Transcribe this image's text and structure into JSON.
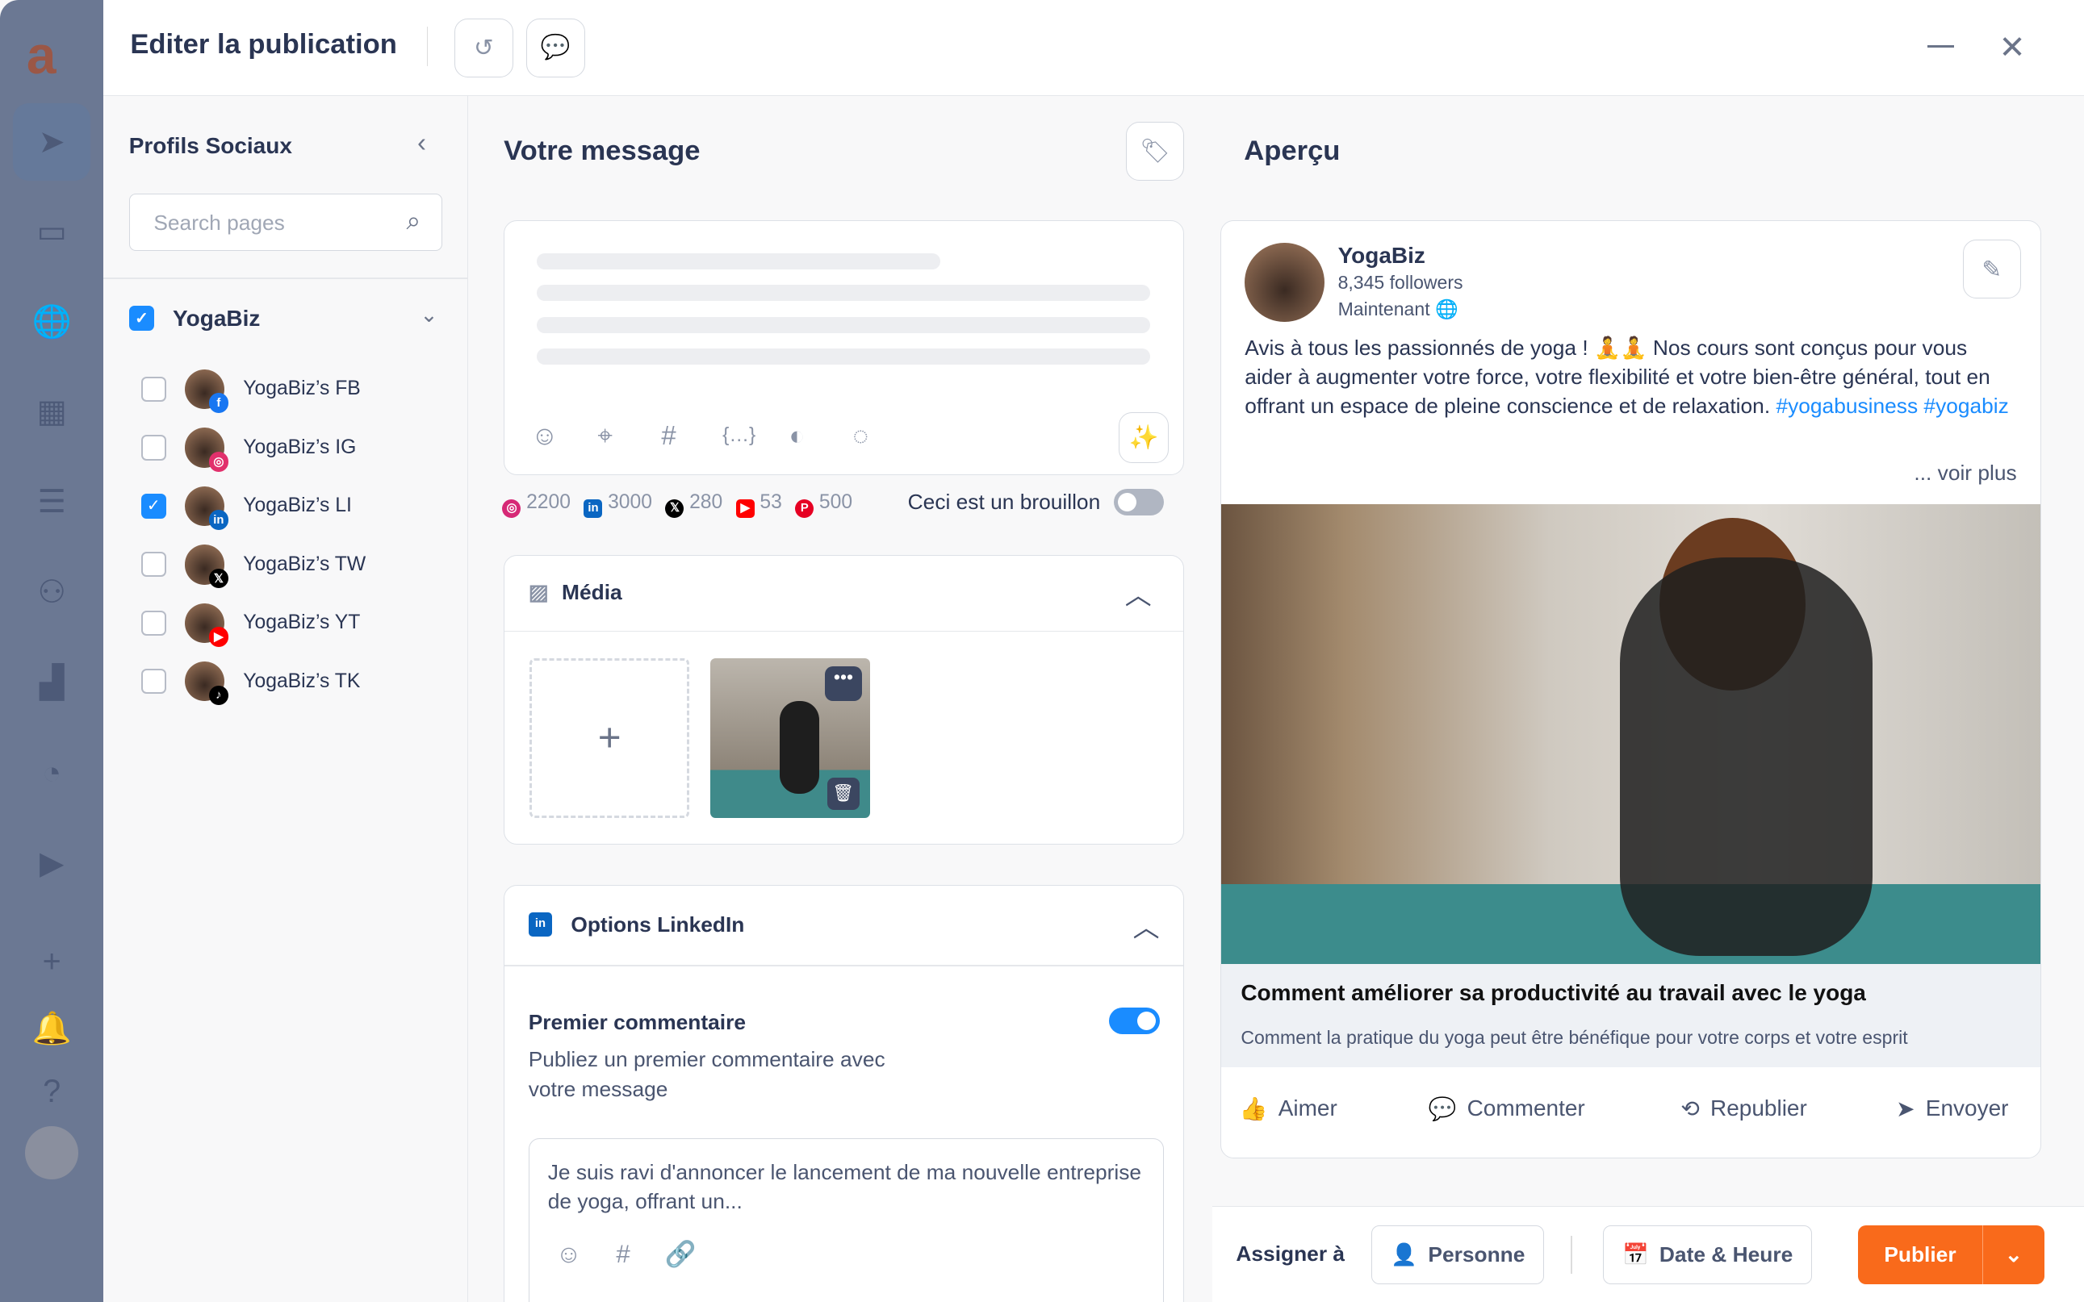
{
  "header": {
    "title": "Editer la publication",
    "history_icon": "history-icon",
    "comments_icon": "comments-icon"
  },
  "profiles": {
    "title": "Profils Sociaux",
    "search_placeholder": "Search pages",
    "group": "YogaBiz",
    "items": [
      {
        "label": "YogaBiz’s FB",
        "checked": false,
        "net": "facebook",
        "color": "#1877f2"
      },
      {
        "label": "YogaBiz’s IG",
        "checked": false,
        "net": "instagram",
        "color": "#e1306c"
      },
      {
        "label": "YogaBiz’s LI",
        "checked": true,
        "net": "linkedin",
        "color": "#0a66c2"
      },
      {
        "label": "YogaBiz’s TW",
        "checked": false,
        "net": "x",
        "color": "#000000"
      },
      {
        "label": "YogaBiz’s YT",
        "checked": false,
        "net": "youtube",
        "color": "#ff0000"
      },
      {
        "label": "YogaBiz’s TK",
        "checked": false,
        "net": "tiktok",
        "color": "#000000"
      }
    ]
  },
  "message": {
    "title": "Votre message",
    "counts": [
      {
        "net": "instagram",
        "value": "2200"
      },
      {
        "net": "linkedin",
        "value": "3000"
      },
      {
        "net": "x",
        "value": "280"
      },
      {
        "net": "youtube",
        "value": "53"
      },
      {
        "net": "pinterest",
        "value": "500"
      }
    ],
    "draft_label": "Ceci est un brouillon",
    "draft_on": false
  },
  "media": {
    "title": "Média"
  },
  "linkedin": {
    "title": "Options LinkedIn",
    "first_comment_title": "Premier commentaire",
    "first_comment_desc": "Publiez un premier commentaire avec votre message",
    "first_comment_on": true,
    "comment_text": "Je suis ravi d'annoncer le lancement de ma nouvelle entreprise de yoga, offrant un..."
  },
  "preview": {
    "title": "Aperçu",
    "name": "YogaBiz",
    "followers": "8,345 followers",
    "time": "Maintenant",
    "text": "Avis à tous les passionnés de yoga ! 🧘🧘 Nos cours sont conçus pour vous aider à augmenter votre force, votre flexibilité et votre bien-être général, tout en offrant un espace de pleine conscience et de relaxation.",
    "hashtags": "#yogabusiness #yogabiz",
    "more": "... voir plus",
    "link_title": "Comment améliorer sa productivité au travail avec le yoga",
    "link_desc": "Comment la pratique du yoga peut être bénéfique pour votre corps et votre esprit",
    "actions": [
      "Aimer",
      "Commenter",
      "Republier",
      "Envoyer"
    ]
  },
  "footer": {
    "assign": "Assigner à",
    "person": "Personne",
    "date": "Date & Heure",
    "publish": "Publier",
    "accent": "#f96a1b"
  }
}
